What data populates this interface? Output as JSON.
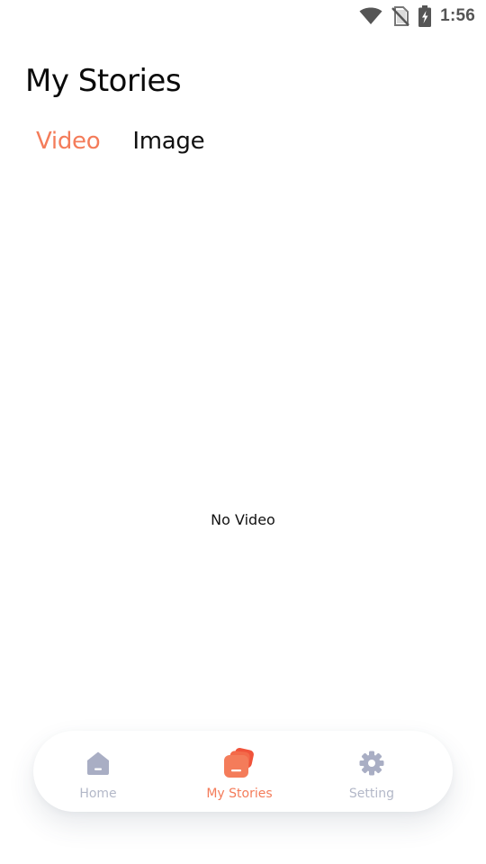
{
  "status_bar": {
    "time": "1:56",
    "icons": [
      "wifi-icon",
      "no-sim-icon",
      "battery-charging-icon"
    ]
  },
  "header": {
    "title": "My Stories"
  },
  "tabs": [
    {
      "label": "Video",
      "active": true
    },
    {
      "label": "Image",
      "active": false
    }
  ],
  "content": {
    "empty_message": "No Video"
  },
  "bottom_nav": {
    "items": [
      {
        "label": "Home",
        "icon": "home-icon",
        "active": false
      },
      {
        "label": "My Stories",
        "icon": "stories-icon",
        "active": true
      },
      {
        "label": "Setting",
        "icon": "gear-icon",
        "active": false
      }
    ]
  },
  "colors": {
    "accent": "#f47c5a",
    "nav_inactive": "#b3b8c8",
    "nav_icon_inactive": "#a9aec4",
    "text": "#111111"
  }
}
